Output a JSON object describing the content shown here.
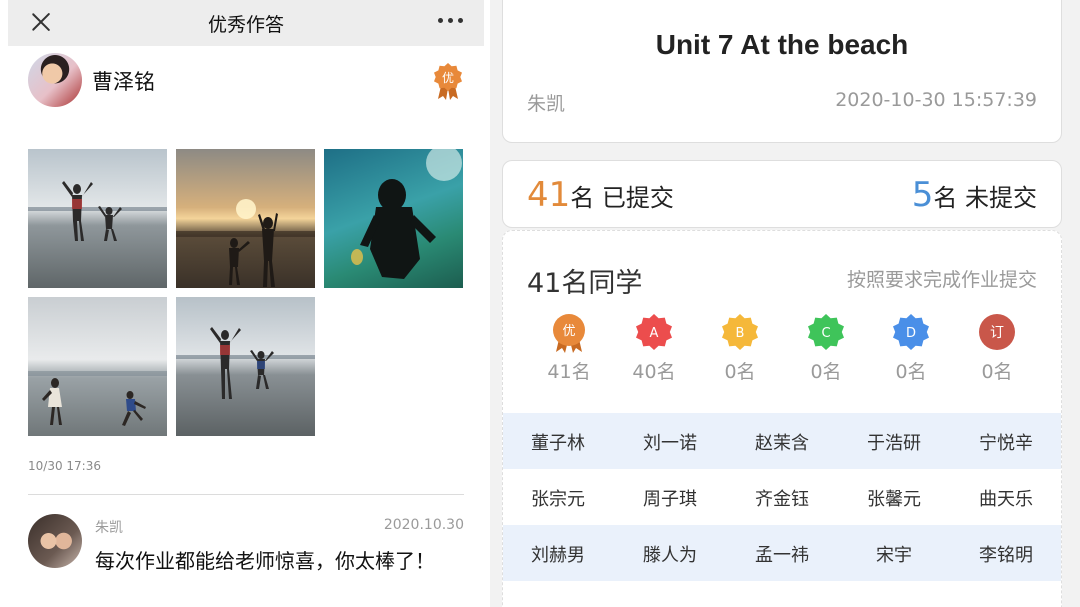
{
  "left_panel": {
    "header": {
      "title": "优秀作答",
      "close_icon": "close-icon",
      "more_icon": "more-icon"
    },
    "student": {
      "name": "曹泽铭",
      "badge": "优",
      "badge_color": "#e8893a"
    },
    "photos": [
      "beach-photo-1",
      "beach-photo-2",
      "beach-photo-3",
      "beach-photo-4",
      "beach-photo-5"
    ],
    "post_time": "10/30 17:36",
    "comment": {
      "author": "朱凯",
      "date": "2020.10.30",
      "text": "每次作业都能给老师惊喜，你太棒了！"
    }
  },
  "right_panel": {
    "homework": {
      "title": "Unit 7 At the beach",
      "teacher": "朱凯",
      "time": "2020-10-30 15:57:39"
    },
    "counts": {
      "submitted_num": "41",
      "submitted_label": "名 已提交",
      "submitted_color": "#e28a3a",
      "unsubmitted_num": "5",
      "unsubmitted_label": "名 未提交",
      "unsubmitted_color": "#4a8fd6"
    },
    "class_summary": {
      "count_label": "41名同学",
      "note": "按照要求完成作业提交"
    },
    "grades": [
      {
        "label": "优",
        "count": "41名",
        "color": "#e8893a"
      },
      {
        "label": "A",
        "count": "40名",
        "color": "#ec4d4d"
      },
      {
        "label": "B",
        "count": "0名",
        "color": "#f5b83a"
      },
      {
        "label": "C",
        "count": "0名",
        "color": "#3fc45a"
      },
      {
        "label": "D",
        "count": "0名",
        "color": "#4a8fe8"
      },
      {
        "label": "订",
        "count": "0名",
        "color": "#c9574a"
      }
    ],
    "students": [
      [
        "董子林",
        "刘一诺",
        "赵茉含",
        "于浩研",
        "宁悦辛"
      ],
      [
        "张宗元",
        "周子琪",
        "齐金钰",
        "张馨元",
        "曲天乐"
      ],
      [
        "刘赫男",
        "滕人为",
        "孟一祎",
        "宋宇",
        "李铭明"
      ]
    ]
  }
}
